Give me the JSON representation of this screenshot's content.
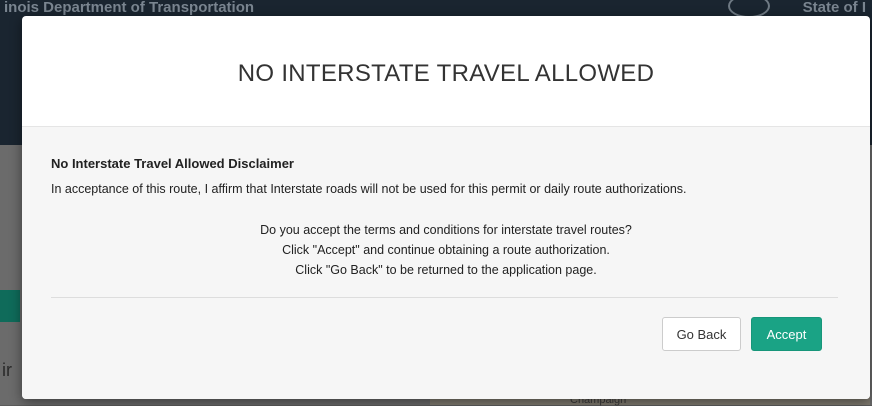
{
  "background": {
    "header_title": "inois Department of Transportation",
    "header_right": "State of I",
    "map_label": "Champaign"
  },
  "modal": {
    "title": "NO INTERSTATE TRAVEL ALLOWED",
    "disclaimer_title": "No Interstate Travel Allowed Disclaimer",
    "disclaimer_text": "In acceptance of this route, I affirm that Interstate roads will not be used for this permit or daily route authorizations.",
    "terms_question": "Do you accept the terms and conditions for interstate travel routes?",
    "terms_accept_hint": "Click \"Accept\" and continue obtaining a route authorization.",
    "terms_back_hint": "Click \"Go Back\" to be returned to the application page.",
    "go_back_label": "Go Back",
    "accept_label": "Accept"
  },
  "colors": {
    "accept_button": "#1aa385",
    "header_bg": "#1a2530"
  }
}
